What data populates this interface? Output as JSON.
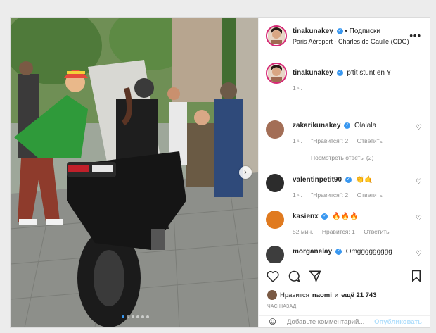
{
  "post": {
    "username": "tinakunakey",
    "follow_label": "Подписки",
    "location": "Paris Aéroport - Charles de Gaulle (CDG)",
    "more_icon": "more-horizontal-icon",
    "colors": {
      "link": "#3897f0",
      "verified": "#3897f0",
      "muted": "#8e8e8e",
      "publish_disabled": "#b2dffc"
    }
  },
  "caption": {
    "username": "tinakunakey",
    "text": "p'tit stunt en Y",
    "time": "1 ч."
  },
  "comments": [
    {
      "username": "zakarikunakey",
      "text": "Olalala",
      "time": "1 ч.",
      "likes": "\"Нравится\": 2",
      "reply": "Ответить"
    },
    {
      "username": "valentinpetit90",
      "text": "👏🤙",
      "time": "1 ч.",
      "likes": "\"Нравится\": 2",
      "reply": "Ответить"
    },
    {
      "username": "kasienx",
      "text": "🔥🔥🔥",
      "time": "52 мин.",
      "likes": "Нравится: 1",
      "reply": "Ответить"
    },
    {
      "username": "morganelay",
      "text": "Omggggggggg",
      "time": "",
      "likes": "",
      "reply": ""
    }
  ],
  "view_replies": "Посмотреть ответы (2)",
  "likes_line": {
    "prefix": "Нравится",
    "user": "naomi",
    "middle": "и",
    "count": "ещё 21 743"
  },
  "timestamp": "час назад",
  "add_comment": {
    "placeholder": "Добавьте комментарий...",
    "publish": "Опубликовать"
  }
}
